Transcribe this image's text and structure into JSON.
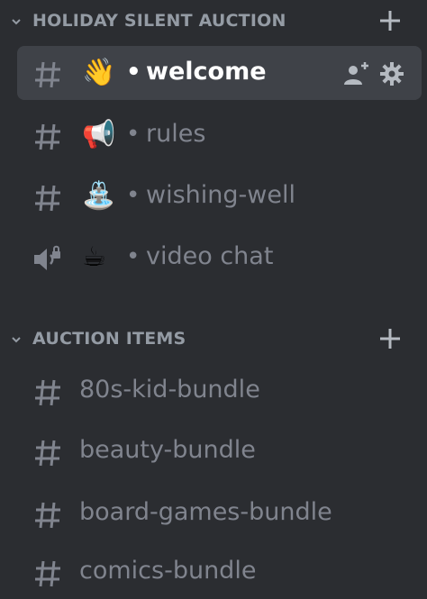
{
  "categories": [
    {
      "label": "HOLIDAY SILENT AUCTION",
      "icon": "chevron-down-icon",
      "add_icon": "plus-icon"
    },
    {
      "label": "AUCTION ITEMS",
      "icon": "chevron-down-icon",
      "add_icon": "plus-icon"
    }
  ],
  "holiday_channels": [
    {
      "name": "welcome",
      "emoji": "👋",
      "separator": "•",
      "type": "text",
      "selected": true
    },
    {
      "name": "rules",
      "emoji": "📢",
      "separator": "•",
      "type": "text"
    },
    {
      "name": "wishing-well",
      "emoji": "⛲",
      "separator": "•",
      "type": "text"
    },
    {
      "name": "video chat",
      "emoji": "☕",
      "separator": "•",
      "type": "voice-locked"
    }
  ],
  "auction_channels": [
    {
      "name": "80s-kid-bundle",
      "type": "text"
    },
    {
      "name": "beauty-bundle",
      "type": "text"
    },
    {
      "name": "board-games-bundle",
      "type": "text"
    },
    {
      "name": "comics-bundle",
      "type": "text"
    }
  ],
  "colors": {
    "background": "#2b2d31",
    "selected_bg": "#3f4248",
    "muted_text": "#80848e",
    "category_text": "#949ba4"
  }
}
